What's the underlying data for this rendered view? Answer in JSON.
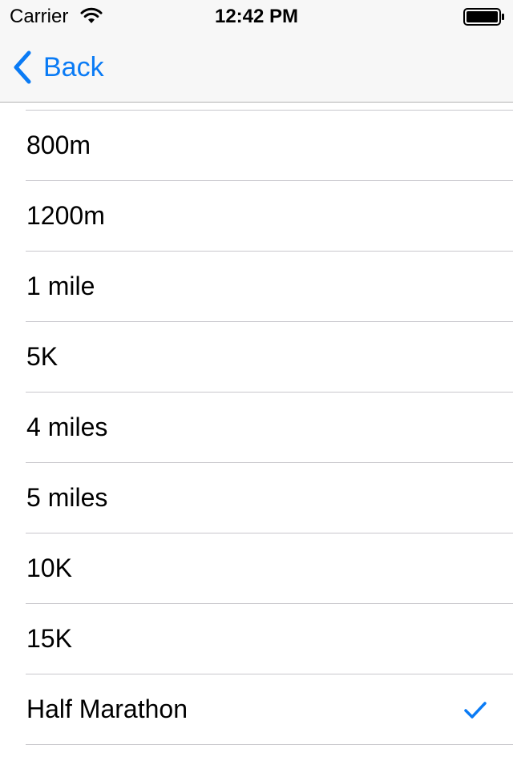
{
  "status_bar": {
    "carrier": "Carrier",
    "time": "12:42 PM"
  },
  "nav": {
    "back_label": "Back"
  },
  "accent_color": "#0a7bf5",
  "distances": [
    {
      "label": "800m",
      "selected": false
    },
    {
      "label": "1200m",
      "selected": false
    },
    {
      "label": "1 mile",
      "selected": false
    },
    {
      "label": "5K",
      "selected": false
    },
    {
      "label": "4 miles",
      "selected": false
    },
    {
      "label": "5 miles",
      "selected": false
    },
    {
      "label": "10K",
      "selected": false
    },
    {
      "label": "15K",
      "selected": false
    },
    {
      "label": "Half Marathon",
      "selected": true
    }
  ]
}
